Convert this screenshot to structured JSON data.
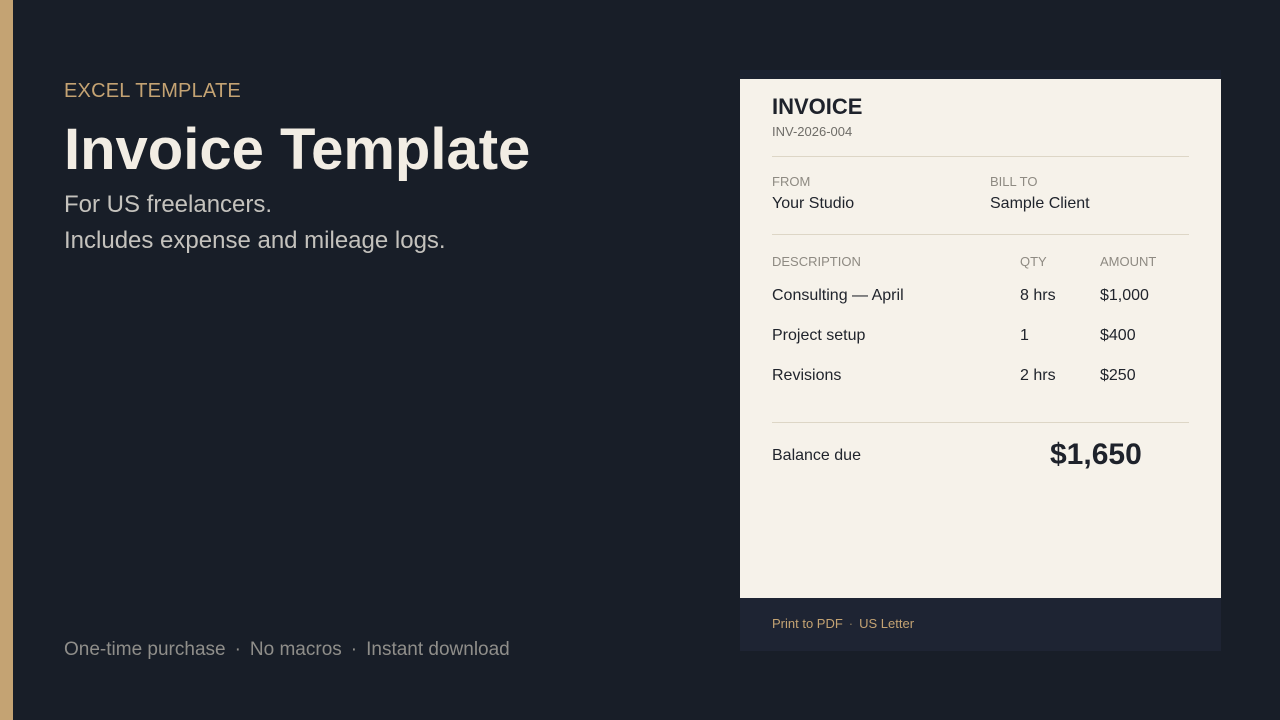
{
  "promo": {
    "eyebrow": "EXCEL TEMPLATE",
    "title": "Invoice Template",
    "subtitle_line1": "For US freelancers.",
    "subtitle_line2": "Includes expense and mileage logs.",
    "features": [
      "One-time purchase",
      "No macros",
      "Instant download"
    ],
    "separator": "·"
  },
  "invoice": {
    "title": "INVOICE",
    "number": "INV-2026-004",
    "from_label": "FROM",
    "from_value": "Your Studio",
    "bill_to_label": "BILL TO",
    "bill_to_value": "Sample Client",
    "columns": {
      "description": "DESCRIPTION",
      "qty": "QTY",
      "amount": "AMOUNT"
    },
    "line_items": [
      {
        "description": "Consulting — April",
        "qty": "8 hrs",
        "amount": "$1,000"
      },
      {
        "description": "Project setup",
        "qty": "1",
        "amount": "$400"
      },
      {
        "description": "Revisions",
        "qty": "2 hrs",
        "amount": "$250"
      }
    ],
    "balance_label": "Balance due",
    "balance_value": "$1,650",
    "footer": [
      "Print to PDF",
      "US Letter"
    ],
    "footer_separator": "·"
  },
  "colors": {
    "background": "#181e28",
    "accent": "#c4a373",
    "paper": "#f6f2ea",
    "ink": "#1e222b"
  }
}
